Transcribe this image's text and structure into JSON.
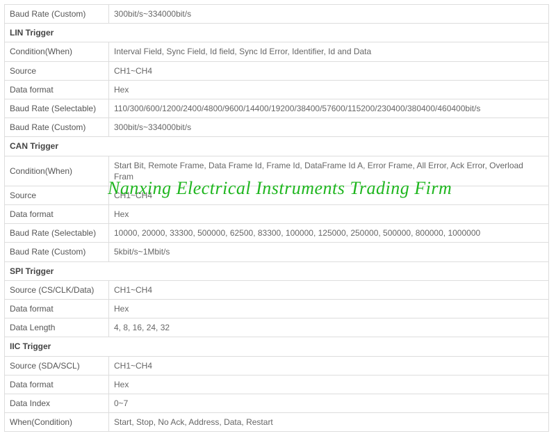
{
  "watermark": "Nanxing Electrical Instruments Trading Firm",
  "rows": [
    {
      "type": "kv",
      "label": "Baud Rate (Custom)",
      "value": "300bit/s~334000bit/s"
    },
    {
      "type": "section",
      "label": "LIN Trigger"
    },
    {
      "type": "kv",
      "label": "Condition(When)",
      "value": "Interval Field, Sync Field, Id field, Sync Id Error, Identifier, Id and Data"
    },
    {
      "type": "kv",
      "label": "Source",
      "value": "CH1~CH4"
    },
    {
      "type": "kv",
      "label": "Data format",
      "value": "Hex"
    },
    {
      "type": "kv",
      "label": "Baud Rate (Selectable)",
      "value": "110/300/600/1200/2400/4800/9600/14400/19200/38400/57600/115200/230400/380400/460400bit/s"
    },
    {
      "type": "kv",
      "label": "Baud Rate (Custom)",
      "value": "300bit/s~334000bit/s"
    },
    {
      "type": "section",
      "label": "CAN Trigger"
    },
    {
      "type": "kv",
      "label": "Condition(When)",
      "value": "Start Bit, Remote Frame, Data Frame Id, Frame Id, DataFrame Id A, Error Frame, All Error, Ack Error, Overload Fram"
    },
    {
      "type": "kv",
      "label": "Source",
      "value": "CH1~CH4"
    },
    {
      "type": "kv",
      "label": "Data format",
      "value": "Hex"
    },
    {
      "type": "kv",
      "label": "Baud Rate (Selectable)",
      "value": "10000, 20000, 33300, 500000, 62500, 83300, 100000, 125000, 250000, 500000, 800000, 1000000"
    },
    {
      "type": "kv",
      "label": "Baud Rate (Custom)",
      "value": "5kbit/s~1Mbit/s"
    },
    {
      "type": "section",
      "label": "SPI Trigger"
    },
    {
      "type": "kv",
      "label": "Source (CS/CLK/Data)",
      "value": "CH1~CH4"
    },
    {
      "type": "kv",
      "label": "Data format",
      "value": "Hex"
    },
    {
      "type": "kv",
      "label": "Data Length",
      "value": "4, 8, 16, 24, 32"
    },
    {
      "type": "section",
      "label": "IIC Trigger"
    },
    {
      "type": "kv",
      "label": "Source (SDA/SCL)",
      "value": "CH1~CH4"
    },
    {
      "type": "kv",
      "label": "Data format",
      "value": "Hex"
    },
    {
      "type": "kv",
      "label": "Data Index",
      "value": "0~7"
    },
    {
      "type": "kv",
      "label": "When(Condition)",
      "value": "Start, Stop, No Ack, Address, Data, Restart"
    }
  ]
}
